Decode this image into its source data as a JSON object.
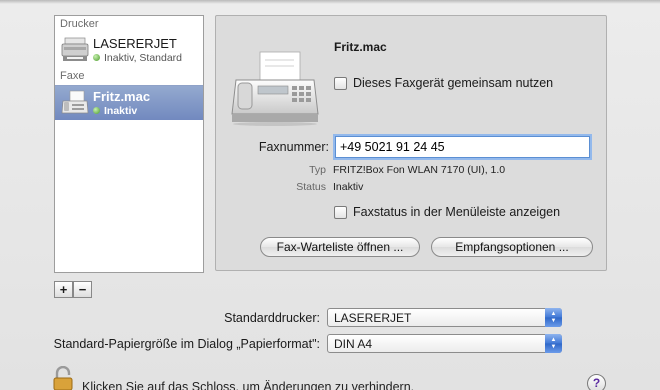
{
  "printer_list": {
    "groups": [
      {
        "header": "Drucker",
        "items": [
          {
            "name": "LASERERJET",
            "status": "Inaktiv, Standard",
            "icon": "laser-printer-icon"
          }
        ]
      },
      {
        "header": "Faxe",
        "items": [
          {
            "name": "Fritz.mac",
            "status": "Inaktiv",
            "icon": "fax-icon"
          }
        ]
      }
    ],
    "add_label": "+",
    "remove_label": "−"
  },
  "detail": {
    "device_name": "Fritz.mac",
    "share_checkbox_label": "Dieses Faxgerät gemeinsam nutzen",
    "fax_number_label": "Faxnummer:",
    "fax_number_value": "+49 5021 91 24 45",
    "type_label": "Typ",
    "type_value": "FRITZ!Box Fon WLAN 7170 (UI), 1.0",
    "status_label": "Status",
    "status_value": "Inaktiv",
    "menubar_checkbox_label": "Faxstatus in der Menüleiste anzeigen",
    "queue_button": "Fax-Warteliste öffnen ...",
    "receive_options_button": "Empfangsoptionen ..."
  },
  "defaults": {
    "default_printer_label": "Standarddrucker:",
    "default_printer_value": "LASERERJET",
    "paper_size_label": "Standard-Papiergröße im Dialog „Papierformat\":",
    "paper_size_value": "DIN A4"
  },
  "footer": {
    "lock_text": "Klicken Sie auf das Schloss, um Änderungen zu verhindern.",
    "help_label": "?"
  },
  "colors": {
    "selection": "#7c92c4",
    "status_dot": "#4a9a2a",
    "focus_ring": "#93b9ec"
  }
}
